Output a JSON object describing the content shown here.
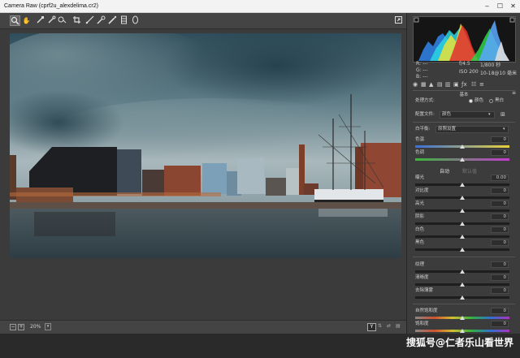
{
  "window": {
    "title": "Camera Raw (cprf2u_alexdelima.cr2)"
  },
  "toolbar": {
    "tools": [
      "zoom-icon",
      "hand-icon",
      "white-balance-icon",
      "color-sampler-icon",
      "targeted-adjust-icon",
      "crop-icon",
      "straighten-icon",
      "spot-removal-icon",
      "red-eye-icon",
      "brush-icon",
      "graduated-filter-icon",
      "radial-filter-icon"
    ],
    "fullscreen": "⛶"
  },
  "camera": {
    "rgb": {
      "r": "R:",
      "g": "G:",
      "b": "B:",
      "dash": "---"
    },
    "aperture": "f/4.5",
    "shutter": "1/800 秒",
    "iso": "ISO 200",
    "lens": "10-18@10 毫米"
  },
  "panel": {
    "section_title": "基本",
    "process_label": "处理方式:",
    "process_color": "颜色",
    "process_bw": "黑白",
    "profile_label": "配置文件:",
    "profile_value": "颜色",
    "wb_label": "白平衡:",
    "wb_value": "原照设置",
    "auto": "自动",
    "default": "默认值"
  },
  "sliders": {
    "temp": {
      "label": "色温",
      "value": "0",
      "pos": 0.5
    },
    "tint": {
      "label": "色调",
      "value": "0",
      "pos": 0.5
    },
    "exposure": {
      "label": "曝光",
      "value": "0.00",
      "pos": 0.5
    },
    "contrast": {
      "label": "对比度",
      "value": "0",
      "pos": 0.5
    },
    "highlights": {
      "label": "高光",
      "value": "0",
      "pos": 0.5
    },
    "shadows": {
      "label": "阴影",
      "value": "0",
      "pos": 0.5
    },
    "whites": {
      "label": "白色",
      "value": "0",
      "pos": 0.5
    },
    "blacks": {
      "label": "黑色",
      "value": "0",
      "pos": 0.5
    },
    "texture": {
      "label": "纹理",
      "value": "0",
      "pos": 0.5
    },
    "clarity": {
      "label": "清晰度",
      "value": "0",
      "pos": 0.5
    },
    "dehaze": {
      "label": "去除薄雾",
      "value": "0",
      "pos": 0.5
    },
    "vibrance": {
      "label": "自然饱和度",
      "value": "0",
      "pos": 0.5
    },
    "saturation": {
      "label": "饱和度",
      "value": "0",
      "pos": 0.5
    }
  },
  "status": {
    "zoom": "20%",
    "minus": "−",
    "plus": "+",
    "y_btn": "Y"
  },
  "watermark": "搜狐号@仁者乐山看世界",
  "colors": {
    "bg": "#3a3a3a",
    "panel": "#3c3c3c",
    "accent": "#3f86c8"
  }
}
